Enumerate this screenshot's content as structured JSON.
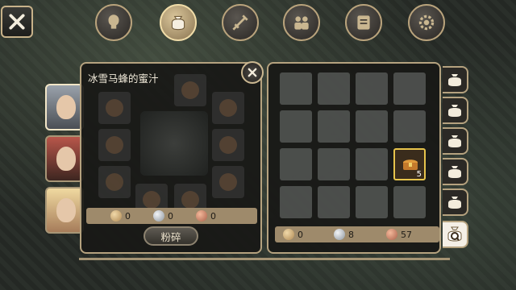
{
  "header": {
    "close_icon": "close-icon",
    "nav": [
      {
        "icon": "head-icon",
        "active": false
      },
      {
        "icon": "bag-icon",
        "active": true
      },
      {
        "icon": "sword-icon",
        "active": false
      },
      {
        "icon": "team-icon",
        "active": false
      },
      {
        "icon": "scroll-icon",
        "active": false
      },
      {
        "icon": "gear-icon",
        "active": false
      }
    ]
  },
  "item_panel": {
    "title": "冰雪马蜂的蜜汁",
    "costs": [
      {
        "type": "gold",
        "value": "0"
      },
      {
        "type": "silver",
        "value": "0"
      },
      {
        "type": "copper",
        "value": "0"
      }
    ],
    "crush_label": "粉碎"
  },
  "characters": [
    {
      "name": "white-hair-hero",
      "active": true
    },
    {
      "name": "red-hair-warrior",
      "active": false
    },
    {
      "name": "blonde-girl",
      "active": false
    }
  ],
  "inventory": {
    "filled_slot": {
      "row": 2,
      "col": 3,
      "item_icon": "treasure-chest-icon",
      "count": "5"
    },
    "currency": [
      {
        "type": "gold",
        "value": "0"
      },
      {
        "type": "silver",
        "value": "8"
      },
      {
        "type": "copper",
        "value": "57"
      }
    ]
  },
  "side_tabs": [
    "bag-icon",
    "bag-icon",
    "bag-icon",
    "bag-icon",
    "bag-icon",
    "quest-bag-icon"
  ],
  "colors": {
    "accent": "#e7c44c",
    "frame": "#b5a27f"
  }
}
